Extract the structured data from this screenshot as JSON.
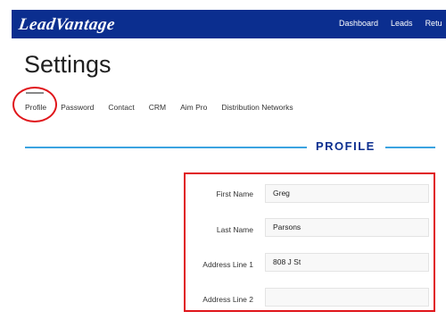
{
  "header": {
    "logo": "LeadVantage",
    "nav": [
      "Dashboard",
      "Leads",
      "Retu"
    ]
  },
  "page": {
    "title": "Settings"
  },
  "tabs": [
    "Profile",
    "Password",
    "Contact",
    "CRM",
    "Aim Pro",
    "Distribution Networks"
  ],
  "active_tab": "Profile",
  "section": {
    "title": "PROFILE"
  },
  "form": {
    "fields": [
      {
        "label": "First Name",
        "value": "Greg"
      },
      {
        "label": "Last Name",
        "value": "Parsons"
      },
      {
        "label": "Address Line 1",
        "value": "808 J St"
      },
      {
        "label": "Address Line 2",
        "value": ""
      }
    ]
  },
  "colors": {
    "header_bg": "#0b2e8f",
    "accent": "#3ba3e0",
    "highlight": "#e0161b"
  }
}
